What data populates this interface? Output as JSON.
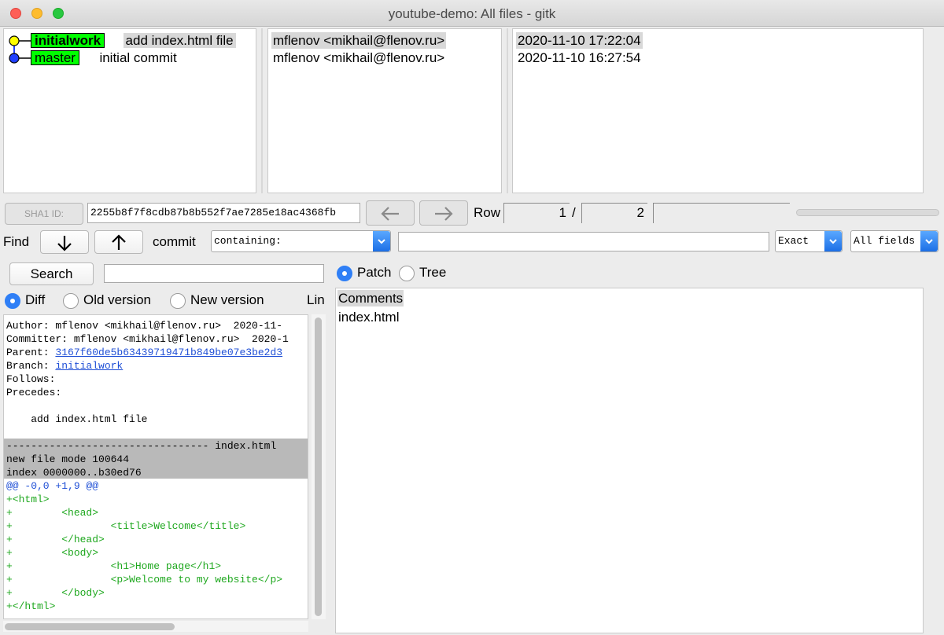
{
  "window": {
    "title": "youtube-demo: All files - gitk"
  },
  "commits": [
    {
      "branch": "initialwork",
      "message": "add index.html file",
      "author": "mflenov <mikhail@flenov.ru>",
      "date": "2020-11-10 17:22:04",
      "selected": true,
      "dot_color": "#ffff00"
    },
    {
      "branch": "master",
      "message": "initial commit",
      "author": "mflenov <mikhail@flenov.ru>",
      "date": "2020-11-10 16:27:54",
      "selected": false,
      "dot_color": "#1f3fff"
    }
  ],
  "sha_row": {
    "sha_label": "SHA1 ID:",
    "sha_value": "2255b8f7f8cdb87b8b552f7ae7285e18ac4368fb",
    "back_icon": "arrow-left-icon",
    "forward_icon": "arrow-right-icon",
    "row_label": "Row",
    "row_current": "1",
    "row_sep": "/",
    "row_total": "2"
  },
  "find_row": {
    "find_label": "Find",
    "down_icon": "arrow-down-icon",
    "up_icon": "arrow-up-icon",
    "commit_label": "commit",
    "mode_value": "containing:",
    "match_value": "Exact",
    "fields_value": "All fields"
  },
  "search_row": {
    "search_label": "Search",
    "patch_label": "Patch",
    "tree_label": "Tree"
  },
  "diff_options": {
    "diff_label": "Diff",
    "old_label": "Old version",
    "new_label": "New version",
    "lines_label": "Lin"
  },
  "diff": {
    "author": "Author: mflenov <mikhail@flenov.ru>  2020-11-",
    "committer": "Committer: mflenov <mikhail@flenov.ru>  2020-1",
    "parent_label": "Parent: ",
    "parent_hash": "3167f60de5b63439719471b849be07e3be2d3",
    "branch_label": "Branch: ",
    "branch_name": "initialwork",
    "follows": "Follows:",
    "precedes": "Precedes:",
    "message": "    add index.html file",
    "file_sep": "--------------------------------- index.html",
    "mode": "new file mode 100644",
    "index": "index 0000000..b30ed76",
    "hunk": "@@ -0,0 +1,9 @@",
    "lines": [
      "+<html>",
      "+        <head>",
      "+                <title>Welcome</title>",
      "+        </head>",
      "+        <body>",
      "+                <h1>Home page</h1>",
      "+                <p>Welcome to my website</p>",
      "+        </body>",
      "+</html>"
    ]
  },
  "files": [
    "Comments",
    "index.html"
  ]
}
